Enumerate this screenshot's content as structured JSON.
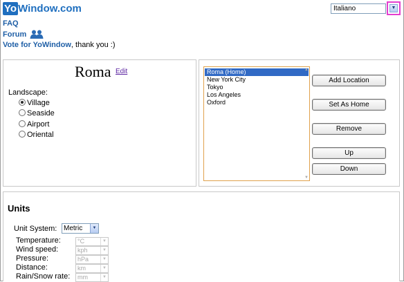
{
  "header": {
    "logo_yo": "Yo",
    "logo_rest": "Window.com",
    "language": "Italiano"
  },
  "links": {
    "faq": "FAQ",
    "forum": "Forum",
    "vote_link": "Vote for YoWindow",
    "vote_text": ", thank you :)"
  },
  "location": {
    "city": "Roma",
    "edit": "Edit",
    "landscape_label": "Landscape:",
    "landscapes": [
      {
        "label": "Village",
        "checked": true
      },
      {
        "label": "Seaside",
        "checked": false
      },
      {
        "label": "Airport",
        "checked": false
      },
      {
        "label": "Oriental",
        "checked": false
      }
    ]
  },
  "locations_list": {
    "items": [
      "Roma (Home)",
      "New York City",
      "Tokyo",
      "Los Angeles",
      "Oxford"
    ],
    "selected": "Roma (Home)"
  },
  "buttons": {
    "add_location": "Add Location",
    "set_as_home": "Set As Home",
    "remove": "Remove",
    "up": "Up",
    "down": "Down"
  },
  "units": {
    "title": "Units",
    "system_label": "Unit System:",
    "system_value": "Metric",
    "rows": [
      {
        "label": "Temperature:",
        "value": "°C"
      },
      {
        "label": "Wind speed:",
        "value": "kph"
      },
      {
        "label": "Pressure:",
        "value": "hPa"
      },
      {
        "label": "Distance:",
        "value": "km"
      },
      {
        "label": "Rain/Snow rate:",
        "value": "mm"
      }
    ]
  },
  "colors": {
    "brand": "#1f6fbf",
    "link": "#1f5fa6",
    "selection": "#316ac5",
    "highlight_border": "#e43ecf"
  }
}
